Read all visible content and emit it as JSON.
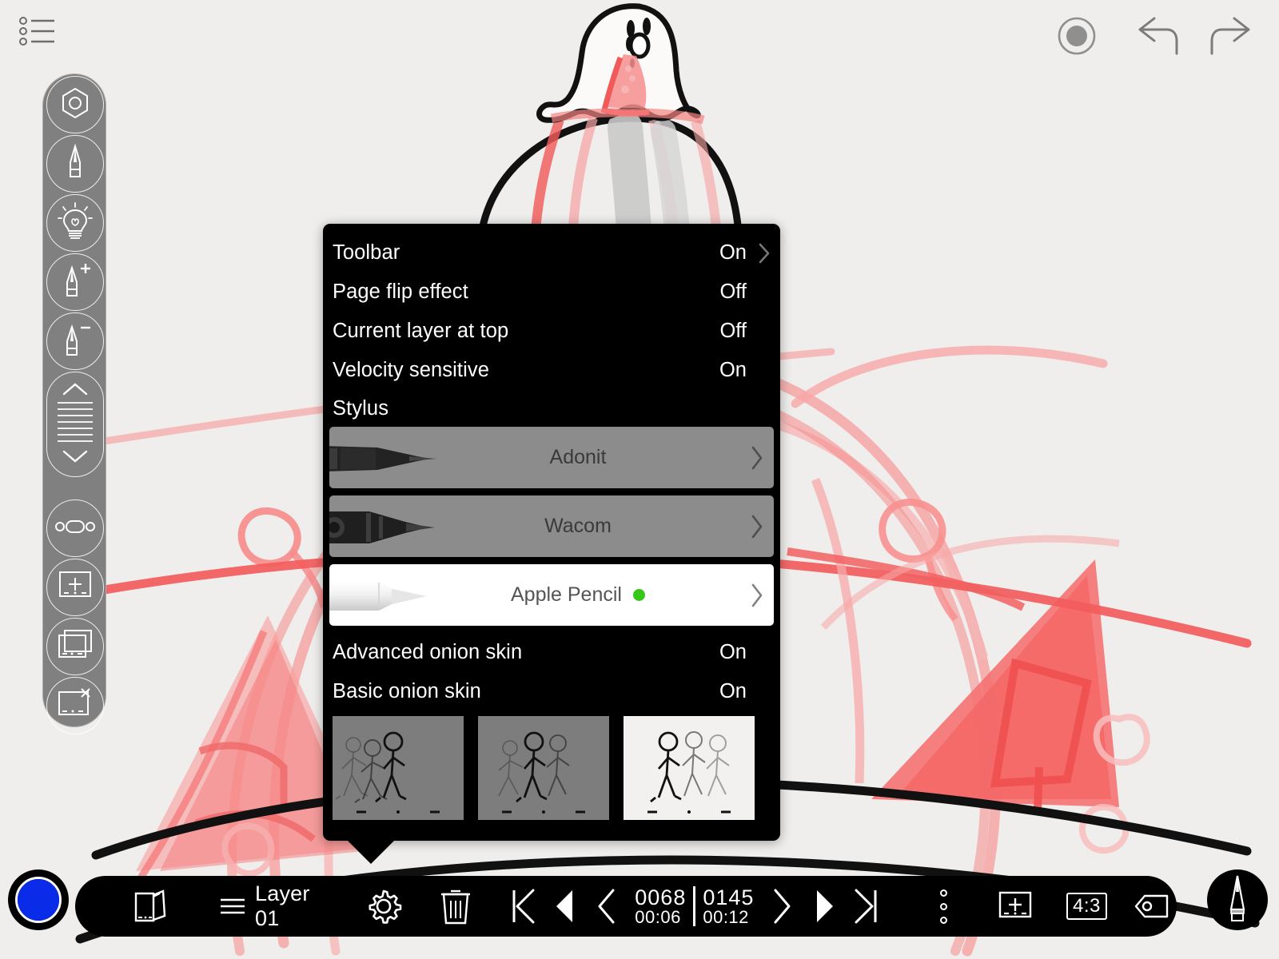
{
  "app": {
    "canvas_background": "#efeeec",
    "artwork_description": "ghost character sitting on large ball, black ink with red onion-skin frames"
  },
  "topbar": {
    "menu_icon": "list-menu-icon",
    "record_label": "record-icon",
    "undo_label": "undo-icon",
    "redo_label": "redo-icon"
  },
  "tool_rail": {
    "items": [
      {
        "name": "color-picker",
        "icon": "hexagon-color-icon"
      },
      {
        "name": "pen",
        "icon": "pen-icon"
      },
      {
        "name": "light",
        "icon": "lightbulb-icon"
      },
      {
        "name": "pen-increase",
        "icon": "pen-plus-icon"
      },
      {
        "name": "pen-decrease",
        "icon": "pen-minus-icon"
      },
      {
        "name": "opacity-slider",
        "icon": "slider-lines-icon"
      },
      {
        "name": "handle",
        "icon": "pill-handle-icon"
      },
      {
        "name": "add-frame",
        "icon": "frame-plus-icon"
      },
      {
        "name": "duplicate-frame",
        "icon": "frame-copy-icon"
      },
      {
        "name": "delete-frame",
        "icon": "frame-x-icon"
      }
    ]
  },
  "settings_popup": {
    "options": [
      {
        "label": "Toolbar",
        "value": "On",
        "chevron": true
      },
      {
        "label": "Page flip effect",
        "value": "Off",
        "chevron": false
      },
      {
        "label": "Current layer at top",
        "value": "Off",
        "chevron": false
      },
      {
        "label": "Velocity sensitive",
        "value": "On",
        "chevron": false
      },
      {
        "label": "Stylus",
        "value": "",
        "chevron": false
      }
    ],
    "stylus_devices": [
      {
        "name": "Adonit",
        "connected": false,
        "style": "grey",
        "chevron": "chevron-right"
      },
      {
        "name": "Wacom",
        "connected": false,
        "style": "grey",
        "chevron": "chevron-right"
      },
      {
        "name": "Apple Pencil",
        "connected": true,
        "style": "white",
        "chevron": "chevron-right",
        "status_color": "#36c818"
      }
    ],
    "onion_options": [
      {
        "label": "Advanced onion skin",
        "value": "On"
      },
      {
        "label": "Basic onion skin",
        "value": "On"
      }
    ],
    "onion_thumbnails": [
      {
        "name": "onion-preview-dark",
        "background": "#7d7d7d"
      },
      {
        "name": "onion-preview-medium",
        "background": "#7d7d7d"
      },
      {
        "name": "onion-preview-light",
        "background": "#f2f1ef"
      }
    ]
  },
  "bottom_bar": {
    "color_swatch": {
      "name": "color-swatch",
      "color": "#0a2ce8"
    },
    "pages_icon": "pages-icon",
    "layer": {
      "icon": "layers-list-icon",
      "label": "Layer 01"
    },
    "settings_icon": "gear-icon",
    "delete_icon": "trash-icon",
    "first_frame_icon": "skip-to-start-icon",
    "prev_play_icon": "play-reverse-icon",
    "step_back_icon": "chevron-left-icon",
    "frame": {
      "current_number": "0068",
      "current_time": "00:06",
      "total_number": "0145",
      "total_time": "00:12"
    },
    "step_forward_icon": "chevron-right-icon",
    "play_icon": "play-icon",
    "last_frame_icon": "skip-to-end-icon",
    "more_icon": "more-vertical-icon",
    "add_frame_icon": "frame-plus-icon",
    "aspect_ratio": "4:3",
    "tag_icon": "tag-icon",
    "brush_tool": {
      "name": "brush-tool",
      "icon": "brush-icon"
    }
  }
}
